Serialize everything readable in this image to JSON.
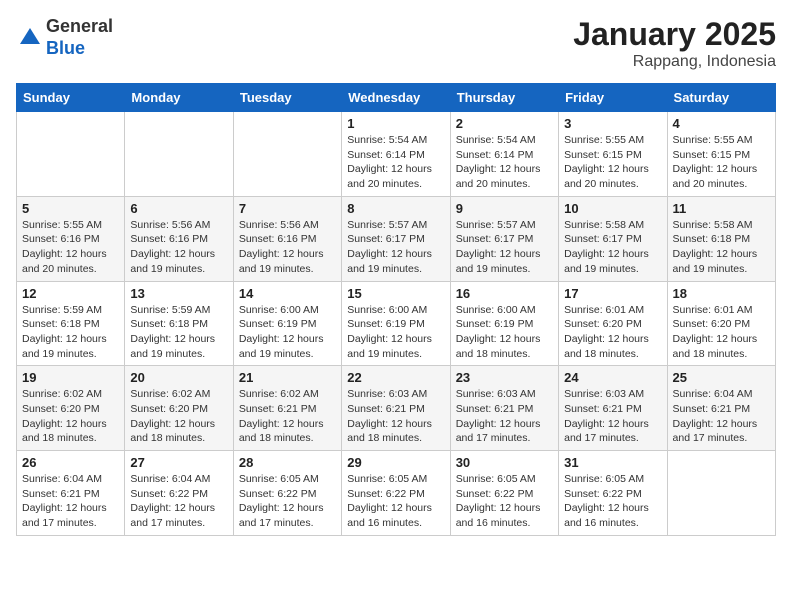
{
  "header": {
    "logo_general": "General",
    "logo_blue": "Blue",
    "month": "January 2025",
    "location": "Rappang, Indonesia"
  },
  "weekdays": [
    "Sunday",
    "Monday",
    "Tuesday",
    "Wednesday",
    "Thursday",
    "Friday",
    "Saturday"
  ],
  "weeks": [
    [
      {
        "day": "",
        "info": ""
      },
      {
        "day": "",
        "info": ""
      },
      {
        "day": "",
        "info": ""
      },
      {
        "day": "1",
        "info": "Sunrise: 5:54 AM\nSunset: 6:14 PM\nDaylight: 12 hours\nand 20 minutes."
      },
      {
        "day": "2",
        "info": "Sunrise: 5:54 AM\nSunset: 6:14 PM\nDaylight: 12 hours\nand 20 minutes."
      },
      {
        "day": "3",
        "info": "Sunrise: 5:55 AM\nSunset: 6:15 PM\nDaylight: 12 hours\nand 20 minutes."
      },
      {
        "day": "4",
        "info": "Sunrise: 5:55 AM\nSunset: 6:15 PM\nDaylight: 12 hours\nand 20 minutes."
      }
    ],
    [
      {
        "day": "5",
        "info": "Sunrise: 5:55 AM\nSunset: 6:16 PM\nDaylight: 12 hours\nand 20 minutes."
      },
      {
        "day": "6",
        "info": "Sunrise: 5:56 AM\nSunset: 6:16 PM\nDaylight: 12 hours\nand 19 minutes."
      },
      {
        "day": "7",
        "info": "Sunrise: 5:56 AM\nSunset: 6:16 PM\nDaylight: 12 hours\nand 19 minutes."
      },
      {
        "day": "8",
        "info": "Sunrise: 5:57 AM\nSunset: 6:17 PM\nDaylight: 12 hours\nand 19 minutes."
      },
      {
        "day": "9",
        "info": "Sunrise: 5:57 AM\nSunset: 6:17 PM\nDaylight: 12 hours\nand 19 minutes."
      },
      {
        "day": "10",
        "info": "Sunrise: 5:58 AM\nSunset: 6:17 PM\nDaylight: 12 hours\nand 19 minutes."
      },
      {
        "day": "11",
        "info": "Sunrise: 5:58 AM\nSunset: 6:18 PM\nDaylight: 12 hours\nand 19 minutes."
      }
    ],
    [
      {
        "day": "12",
        "info": "Sunrise: 5:59 AM\nSunset: 6:18 PM\nDaylight: 12 hours\nand 19 minutes."
      },
      {
        "day": "13",
        "info": "Sunrise: 5:59 AM\nSunset: 6:18 PM\nDaylight: 12 hours\nand 19 minutes."
      },
      {
        "day": "14",
        "info": "Sunrise: 6:00 AM\nSunset: 6:19 PM\nDaylight: 12 hours\nand 19 minutes."
      },
      {
        "day": "15",
        "info": "Sunrise: 6:00 AM\nSunset: 6:19 PM\nDaylight: 12 hours\nand 19 minutes."
      },
      {
        "day": "16",
        "info": "Sunrise: 6:00 AM\nSunset: 6:19 PM\nDaylight: 12 hours\nand 18 minutes."
      },
      {
        "day": "17",
        "info": "Sunrise: 6:01 AM\nSunset: 6:20 PM\nDaylight: 12 hours\nand 18 minutes."
      },
      {
        "day": "18",
        "info": "Sunrise: 6:01 AM\nSunset: 6:20 PM\nDaylight: 12 hours\nand 18 minutes."
      }
    ],
    [
      {
        "day": "19",
        "info": "Sunrise: 6:02 AM\nSunset: 6:20 PM\nDaylight: 12 hours\nand 18 minutes."
      },
      {
        "day": "20",
        "info": "Sunrise: 6:02 AM\nSunset: 6:20 PM\nDaylight: 12 hours\nand 18 minutes."
      },
      {
        "day": "21",
        "info": "Sunrise: 6:02 AM\nSunset: 6:21 PM\nDaylight: 12 hours\nand 18 minutes."
      },
      {
        "day": "22",
        "info": "Sunrise: 6:03 AM\nSunset: 6:21 PM\nDaylight: 12 hours\nand 18 minutes."
      },
      {
        "day": "23",
        "info": "Sunrise: 6:03 AM\nSunset: 6:21 PM\nDaylight: 12 hours\nand 17 minutes."
      },
      {
        "day": "24",
        "info": "Sunrise: 6:03 AM\nSunset: 6:21 PM\nDaylight: 12 hours\nand 17 minutes."
      },
      {
        "day": "25",
        "info": "Sunrise: 6:04 AM\nSunset: 6:21 PM\nDaylight: 12 hours\nand 17 minutes."
      }
    ],
    [
      {
        "day": "26",
        "info": "Sunrise: 6:04 AM\nSunset: 6:21 PM\nDaylight: 12 hours\nand 17 minutes."
      },
      {
        "day": "27",
        "info": "Sunrise: 6:04 AM\nSunset: 6:22 PM\nDaylight: 12 hours\nand 17 minutes."
      },
      {
        "day": "28",
        "info": "Sunrise: 6:05 AM\nSunset: 6:22 PM\nDaylight: 12 hours\nand 17 minutes."
      },
      {
        "day": "29",
        "info": "Sunrise: 6:05 AM\nSunset: 6:22 PM\nDaylight: 12 hours\nand 16 minutes."
      },
      {
        "day": "30",
        "info": "Sunrise: 6:05 AM\nSunset: 6:22 PM\nDaylight: 12 hours\nand 16 minutes."
      },
      {
        "day": "31",
        "info": "Sunrise: 6:05 AM\nSunset: 6:22 PM\nDaylight: 12 hours\nand 16 minutes."
      },
      {
        "day": "",
        "info": ""
      }
    ]
  ]
}
